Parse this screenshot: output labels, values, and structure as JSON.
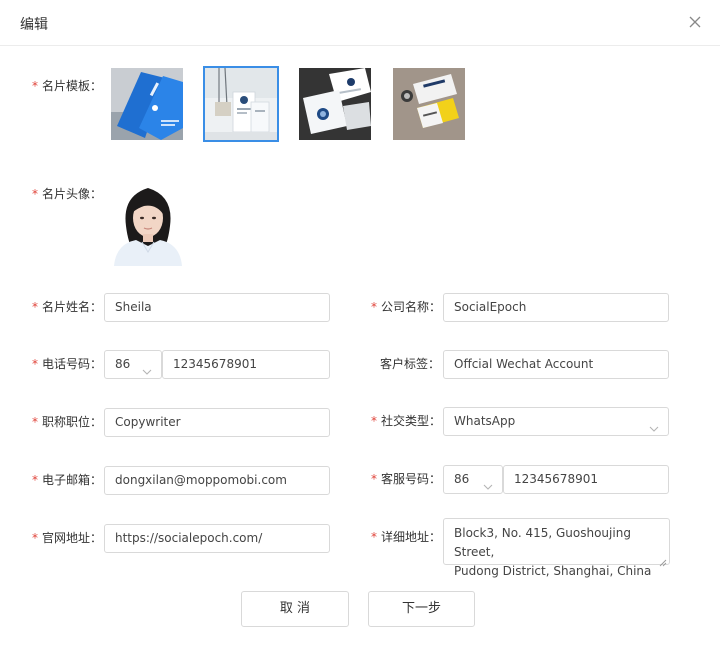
{
  "dialog": {
    "title": "编辑"
  },
  "form": {
    "template": {
      "label": "名片模板：",
      "required": "*"
    },
    "avatar": {
      "label": "名片头像：",
      "required": "*"
    },
    "name": {
      "label": "名片姓名：",
      "required": "*",
      "value": "Sheila"
    },
    "company": {
      "label": "公司名称：",
      "required": "*",
      "value": "SocialEpoch"
    },
    "phone": {
      "label": "电话号码：",
      "required": "*",
      "code": "86",
      "value": "12345678901"
    },
    "customer_tag": {
      "label": "客户标签：",
      "value": "Offcial Wechat Account"
    },
    "job_title": {
      "label": "职称职位：",
      "required": "*",
      "value": "Copywriter"
    },
    "social_type": {
      "label": "社交类型：",
      "required": "*",
      "value": "WhatsApp"
    },
    "email": {
      "label": "电子邮箱：",
      "required": "*",
      "value": "dongxilan@moppomobi.com"
    },
    "service_phone": {
      "label": "客服号码：",
      "required": "*",
      "code": "86",
      "value": "12345678901"
    },
    "website": {
      "label": "官网地址：",
      "required": "*",
      "value": "https://socialepoch.com/"
    },
    "address": {
      "label": "详细地址：",
      "required": "*",
      "line1": "Block3, No. 415, Guoshoujing Street,",
      "line2": "Pudong District, Shanghai, China"
    }
  },
  "buttons": {
    "cancel": "取 消",
    "next": "下一步"
  },
  "icons": {
    "close": "close-icon",
    "chevron": "chevron-down-icon"
  },
  "colors": {
    "required": "#e0443a",
    "selected_border": "#3a8ee6",
    "border": "#d9d9d9"
  }
}
